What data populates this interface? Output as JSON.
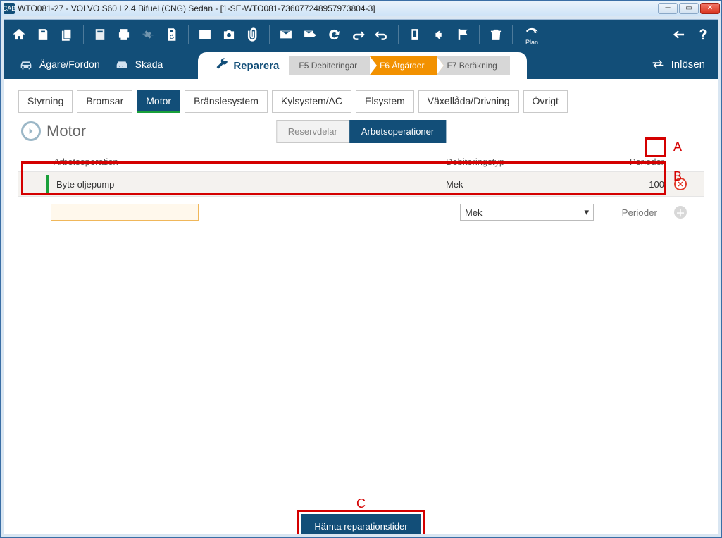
{
  "window": {
    "app_icon_text": "CAB",
    "title": "WTO081-27 - VOLVO S60 I 2.4 Bifuel (CNG) Sedan - [1-SE-WTO081-736077248957973804-3]"
  },
  "toolbar": {
    "plan_label": "Plan"
  },
  "nav": {
    "owner_vehicle": "Ägare/Fordon",
    "damage": "Skada",
    "repair": "Reparera",
    "redeem": "Inlösen",
    "steps": [
      {
        "label": "F5  Debiteringar",
        "active": false
      },
      {
        "label": "F6  Åtgärder",
        "active": true
      },
      {
        "label": "F7  Beräkning",
        "active": false
      }
    ]
  },
  "categories": {
    "tabs": [
      "Styrning",
      "Bromsar",
      "Motor",
      "Bränslesystem",
      "Kylsystem/AC",
      "Elsystem",
      "Växellåda/Drivning",
      "Övrigt"
    ],
    "active_index": 2
  },
  "heading": "Motor",
  "subtabs": {
    "spare_parts": "Reservdelar",
    "operations": "Arbetsoperationer"
  },
  "table": {
    "headers": {
      "operation": "Arbetsoperation",
      "charge_type": "Debiteringstyp",
      "periods": "Perioder"
    },
    "rows": [
      {
        "operation": "Byte oljepump",
        "charge_type": "Mek",
        "periods": "100"
      }
    ],
    "input_row": {
      "operation_value": "",
      "charge_type_selected": "Mek",
      "periods_placeholder": "Perioder"
    }
  },
  "bottom": {
    "fetch_times": "Hämta reparationstider"
  },
  "annotations": {
    "a": "A",
    "b": "B",
    "c": "C"
  }
}
